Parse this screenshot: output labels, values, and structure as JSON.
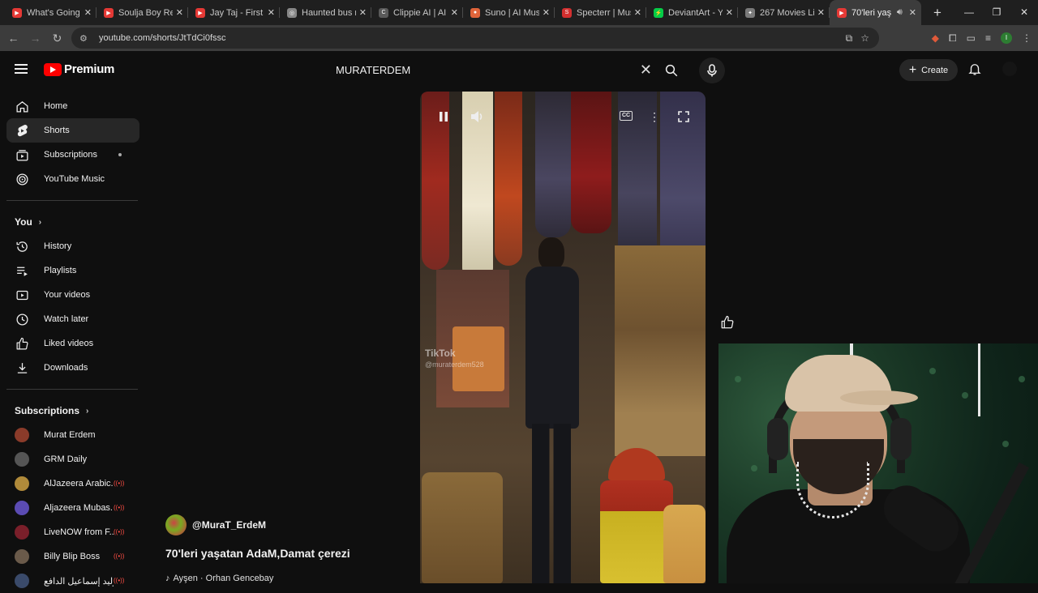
{
  "browser": {
    "tabs": [
      {
        "title": "What's Going",
        "color": "#e53935",
        "glyph": "▶",
        "active": false
      },
      {
        "title": "Soulja Boy Re",
        "color": "#e53935",
        "glyph": "▶",
        "active": false
      },
      {
        "title": "Jay Taj - First F",
        "color": "#e53935",
        "glyph": "▶",
        "active": false
      },
      {
        "title": "Haunted bus r",
        "color": "#888888",
        "glyph": "◎",
        "active": false
      },
      {
        "title": "Clippie AI | AI",
        "color": "#5a5a5a",
        "glyph": "C",
        "active": false
      },
      {
        "title": "Suno | AI Musi",
        "color": "#e0643a",
        "glyph": "●",
        "active": false
      },
      {
        "title": "Specterr | Mus",
        "color": "#d32f2f",
        "glyph": "S",
        "active": false
      },
      {
        "title": "DeviantArt - Y",
        "color": "#05cc47",
        "glyph": "⚡",
        "active": false
      },
      {
        "title": "267 Movies Li",
        "color": "#7a7a7a",
        "glyph": "✦",
        "active": false
      },
      {
        "title": "70'leri yaş",
        "color": "#e53935",
        "glyph": "▶",
        "active": true
      }
    ],
    "new_tab": "+",
    "url": "youtube.com/shorts/JtTdCi0fssc",
    "profile_initial": "I"
  },
  "header": {
    "logo_text": "Premium",
    "search_value": "MURATERDEM",
    "create_label": "Create"
  },
  "sidebar": {
    "main": [
      {
        "label": "Home",
        "icon": "home-icon"
      },
      {
        "label": "Shorts",
        "icon": "shorts-icon",
        "active": true
      },
      {
        "label": "Subscriptions",
        "icon": "subscriptions-icon",
        "dot": true
      },
      {
        "label": "YouTube Music",
        "icon": "youtube-music-icon"
      }
    ],
    "you_heading": "You",
    "you": [
      {
        "label": "History",
        "icon": "history-icon"
      },
      {
        "label": "Playlists",
        "icon": "playlists-icon"
      },
      {
        "label": "Your videos",
        "icon": "your-videos-icon"
      },
      {
        "label": "Watch later",
        "icon": "watch-later-icon"
      },
      {
        "label": "Liked videos",
        "icon": "liked-videos-icon"
      },
      {
        "label": "Downloads",
        "icon": "downloads-icon"
      }
    ],
    "subs_heading": "Subscriptions",
    "subscriptions": [
      {
        "label": "Murat Erdem",
        "avatar": "#8a3b2a",
        "live": false
      },
      {
        "label": "GRM Daily",
        "avatar": "#555555",
        "live": false
      },
      {
        "label": "AlJazeera Arabic...",
        "avatar": "#b08a3a",
        "live": true
      },
      {
        "label": "Aljazeera Mubas...",
        "avatar": "#5b4bb3",
        "live": true
      },
      {
        "label": "LiveNOW from F...",
        "avatar": "#7a1f2a",
        "live": true
      },
      {
        "label": "Billy Blip Boss",
        "avatar": "#6a5a4a",
        "live": true
      },
      {
        "label": "وليد إسماعيل الدافع",
        "avatar": "#3a4a6a",
        "live": true
      }
    ]
  },
  "video": {
    "watermark_app": "TikTok",
    "watermark_handle": "@muraterdem528",
    "cc_label": "CC"
  },
  "channel": {
    "handle": "@MuraT_ErdeM",
    "title": "70'leri yaşatan AdaM,Damat çerezi",
    "music": "Ayşen · Orhan Gencebay"
  }
}
